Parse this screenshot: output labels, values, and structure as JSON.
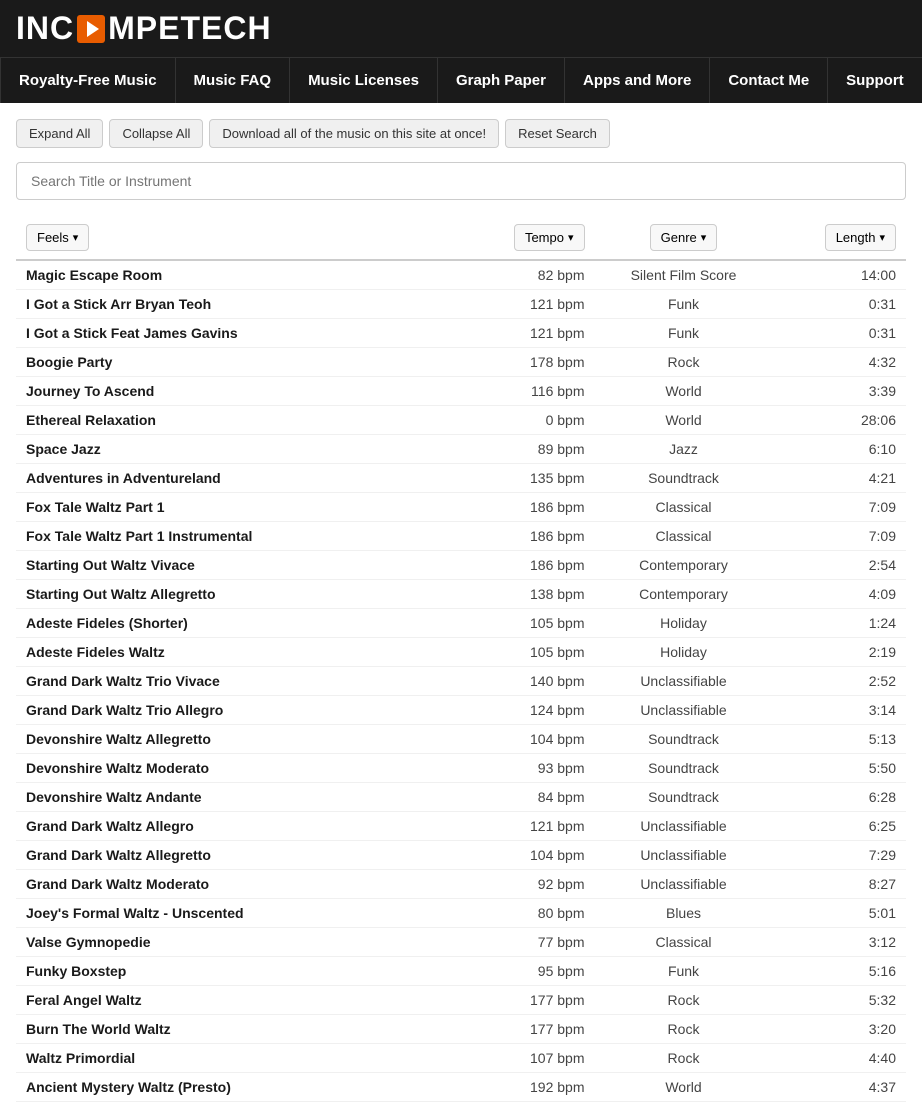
{
  "logo": {
    "part1": "INC",
    "part2": "MPETECH"
  },
  "nav": {
    "items": [
      {
        "label": "Royalty-Free Music",
        "id": "royalty-free-music"
      },
      {
        "label": "Music FAQ",
        "id": "music-faq"
      },
      {
        "label": "Music Licenses",
        "id": "music-licenses"
      },
      {
        "label": "Graph Paper",
        "id": "graph-paper"
      },
      {
        "label": "Apps and More",
        "id": "apps-and-more"
      },
      {
        "label": "Contact Me",
        "id": "contact-me"
      },
      {
        "label": "Support",
        "id": "support"
      }
    ]
  },
  "toolbar": {
    "expand_all": "Expand All",
    "collapse_all": "Collapse All",
    "download_all": "Download all of the music on this site at once!",
    "reset_search": "Reset Search"
  },
  "search": {
    "placeholder": "Search Title or Instrument"
  },
  "table": {
    "headers": {
      "feels": "Feels",
      "tempo": "Tempo",
      "genre": "Genre",
      "length": "Length"
    },
    "songs": [
      {
        "title": "Magic Escape Room",
        "tempo": "82 bpm",
        "genre": "Silent Film Score",
        "length": "14:00"
      },
      {
        "title": "I Got a Stick Arr Bryan Teoh",
        "tempo": "121 bpm",
        "genre": "Funk",
        "length": "0:31"
      },
      {
        "title": "I Got a Stick Feat James Gavins",
        "tempo": "121 bpm",
        "genre": "Funk",
        "length": "0:31"
      },
      {
        "title": "Boogie Party",
        "tempo": "178 bpm",
        "genre": "Rock",
        "length": "4:32"
      },
      {
        "title": "Journey To Ascend",
        "tempo": "116 bpm",
        "genre": "World",
        "length": "3:39"
      },
      {
        "title": "Ethereal Relaxation",
        "tempo": "0 bpm",
        "genre": "World",
        "length": "28:06"
      },
      {
        "title": "Space Jazz",
        "tempo": "89 bpm",
        "genre": "Jazz",
        "length": "6:10"
      },
      {
        "title": "Adventures in Adventureland",
        "tempo": "135 bpm",
        "genre": "Soundtrack",
        "length": "4:21"
      },
      {
        "title": "Fox Tale Waltz Part 1",
        "tempo": "186 bpm",
        "genre": "Classical",
        "length": "7:09"
      },
      {
        "title": "Fox Tale Waltz Part 1 Instrumental",
        "tempo": "186 bpm",
        "genre": "Classical",
        "length": "7:09"
      },
      {
        "title": "Starting Out Waltz Vivace",
        "tempo": "186 bpm",
        "genre": "Contemporary",
        "length": "2:54"
      },
      {
        "title": "Starting Out Waltz Allegretto",
        "tempo": "138 bpm",
        "genre": "Contemporary",
        "length": "4:09"
      },
      {
        "title": "Adeste Fideles (Shorter)",
        "tempo": "105 bpm",
        "genre": "Holiday",
        "length": "1:24"
      },
      {
        "title": "Adeste Fideles Waltz",
        "tempo": "105 bpm",
        "genre": "Holiday",
        "length": "2:19"
      },
      {
        "title": "Grand Dark Waltz Trio Vivace",
        "tempo": "140 bpm",
        "genre": "Unclassifiable",
        "length": "2:52"
      },
      {
        "title": "Grand Dark Waltz Trio Allegro",
        "tempo": "124 bpm",
        "genre": "Unclassifiable",
        "length": "3:14"
      },
      {
        "title": "Devonshire Waltz Allegretto",
        "tempo": "104 bpm",
        "genre": "Soundtrack",
        "length": "5:13"
      },
      {
        "title": "Devonshire Waltz Moderato",
        "tempo": "93 bpm",
        "genre": "Soundtrack",
        "length": "5:50"
      },
      {
        "title": "Devonshire Waltz Andante",
        "tempo": "84 bpm",
        "genre": "Soundtrack",
        "length": "6:28"
      },
      {
        "title": "Grand Dark Waltz Allegro",
        "tempo": "121 bpm",
        "genre": "Unclassifiable",
        "length": "6:25"
      },
      {
        "title": "Grand Dark Waltz Allegretto",
        "tempo": "104 bpm",
        "genre": "Unclassifiable",
        "length": "7:29"
      },
      {
        "title": "Grand Dark Waltz Moderato",
        "tempo": "92 bpm",
        "genre": "Unclassifiable",
        "length": "8:27"
      },
      {
        "title": "Joey's Formal Waltz - Unscented",
        "tempo": "80 bpm",
        "genre": "Blues",
        "length": "5:01"
      },
      {
        "title": "Valse Gymnopedie",
        "tempo": "77 bpm",
        "genre": "Classical",
        "length": "3:12"
      },
      {
        "title": "Funky Boxstep",
        "tempo": "95 bpm",
        "genre": "Funk",
        "length": "5:16"
      },
      {
        "title": "Feral Angel Waltz",
        "tempo": "177 bpm",
        "genre": "Rock",
        "length": "5:32"
      },
      {
        "title": "Burn The World Waltz",
        "tempo": "177 bpm",
        "genre": "Rock",
        "length": "3:20"
      },
      {
        "title": "Waltz Primordial",
        "tempo": "107 bpm",
        "genre": "Rock",
        "length": "4:40"
      },
      {
        "title": "Ancient Mystery Waltz (Presto)",
        "tempo": "192 bpm",
        "genre": "World",
        "length": "4:37"
      }
    ]
  }
}
